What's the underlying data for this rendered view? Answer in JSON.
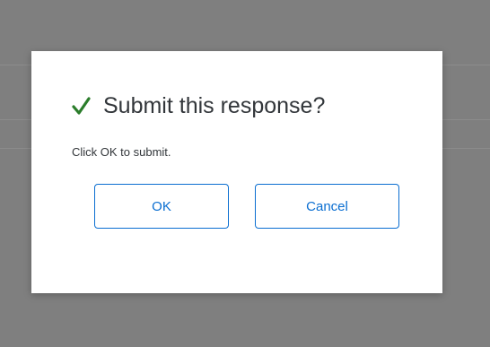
{
  "dialog": {
    "title": "Submit this response?",
    "message": "Click OK to submit.",
    "ok_label": "OK",
    "cancel_label": "Cancel",
    "icon": "checkmark-icon"
  },
  "colors": {
    "overlay": "#7f7f7f",
    "dialog_background": "#ffffff",
    "check_color": "#2b7d2b",
    "button_accent": "#0a6ed1",
    "text": "#32363a"
  }
}
